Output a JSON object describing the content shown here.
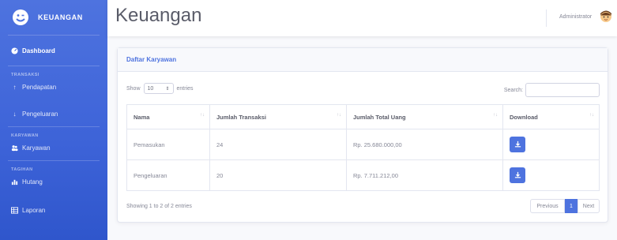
{
  "sidebar": {
    "brand": "KEUANGAN",
    "dashboard_label": "Dashboard",
    "sections": [
      {
        "heading": "TRANSAKSI",
        "items": [
          {
            "label": "Pendapatan"
          },
          {
            "label": "Pengeluaran"
          }
        ]
      },
      {
        "heading": "KARYAWAN",
        "items": [
          {
            "label": "Karyawan"
          }
        ]
      },
      {
        "heading": "TAGIHAN",
        "items": [
          {
            "label": "Hutang"
          },
          {
            "label": "Laporan"
          }
        ]
      }
    ]
  },
  "topbar": {
    "title": "Keuangan",
    "user_name": "Administrator"
  },
  "card": {
    "header": "Daftar Karyawan",
    "show_label": "Show",
    "entries_value": "10",
    "entries_label": "entries",
    "search_label": "Search:",
    "search_value": "",
    "columns": [
      "Nama",
      "Jumlah Transaksi",
      "Jumlah Total Uang",
      "Download"
    ],
    "rows": [
      {
        "nama": "Pemasukan",
        "transaksi": "24",
        "total": "Rp. 25.680.000,00"
      },
      {
        "nama": "Pengeluaran",
        "transaksi": "20",
        "total": "Rp. 7.711.212,00"
      }
    ],
    "info": "Showing 1 to 2 of 2 entries",
    "pagination": {
      "previous": "Previous",
      "current": "1",
      "next": "Next"
    }
  },
  "colors": {
    "primary": "#4e73df",
    "sidebar_dark": "#2f56cc",
    "text_muted": "#858796",
    "heading_text": "#5a5c69"
  },
  "icons": {
    "brand": "laugh-wink-icon",
    "dashboard": "tachometer-icon",
    "pendapatan": "arrow-up-icon",
    "pengeluaran": "arrow-down-icon",
    "karyawan": "users-icon",
    "hutang": "bar-chart-icon",
    "laporan": "table-icon",
    "download": "download-icon",
    "sort": "sort-icon"
  }
}
